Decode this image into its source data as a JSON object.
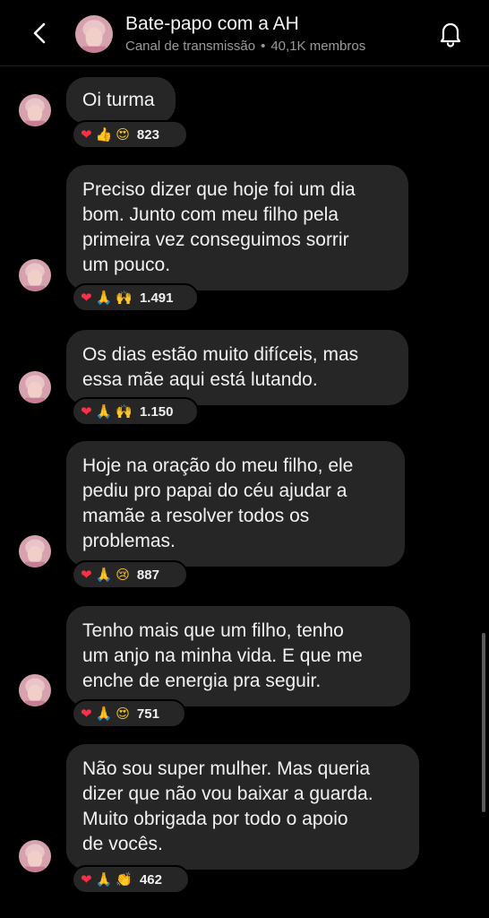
{
  "header": {
    "title": "Bate-papo com a AH",
    "subtitle_type": "Canal de transmissão",
    "subtitle_separator": "•",
    "subtitle_members": "40,1K membros"
  },
  "colors": {
    "background": "#000000",
    "bubble": "#262626",
    "heart": "#ff2d45"
  },
  "messages": [
    {
      "lines": [
        "Oi turma"
      ],
      "reactions": [
        "heart",
        "thumbs-up",
        "heart-eyes"
      ],
      "count": "823"
    },
    {
      "lines": [
        "Preciso dizer que hoje foi um dia",
        "bom. Junto com meu filho pela",
        "primeira vez conseguimos sorrir",
        "um pouco."
      ],
      "reactions": [
        "heart",
        "praying-hands",
        "raised-hands"
      ],
      "count": "1.491"
    },
    {
      "lines": [
        "Os dias estão muito difíceis, mas",
        "essa mãe aqui está lutando."
      ],
      "reactions": [
        "heart",
        "praying-hands",
        "raised-hands"
      ],
      "count": "1.150"
    },
    {
      "lines": [
        "Hoje na oração do meu filho, ele",
        "pediu pro papai do céu ajudar a",
        "mamãe a resolver todos os",
        "problemas."
      ],
      "reactions": [
        "heart",
        "praying-hands",
        "crying-face"
      ],
      "count": "887"
    },
    {
      "lines": [
        "Tenho mais que um filho, tenho",
        "um anjo na minha vida. E que me",
        "enche de energia pra seguir."
      ],
      "reactions": [
        "heart",
        "praying-hands",
        "heart-eyes"
      ],
      "count": "751"
    },
    {
      "lines": [
        "Não sou super mulher. Mas queria",
        "dizer que não vou baixar a guarda.",
        "Muito obrigada por todo o apoio",
        "de vocês."
      ],
      "reactions": [
        "heart",
        "praying-hands",
        "clapping-hands"
      ],
      "count": "462"
    }
  ]
}
